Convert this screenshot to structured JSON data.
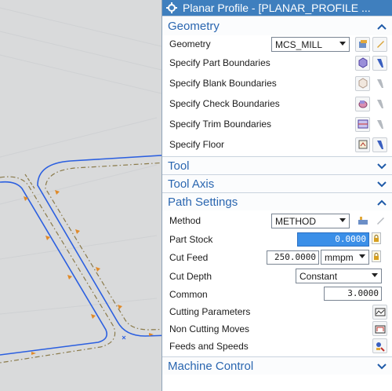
{
  "dialog": {
    "title": "Planar Profile - [PLANAR_PROFILE ..."
  },
  "geometry": {
    "header": "Geometry",
    "geometry_label": "Geometry",
    "geometry_value": "MCS_MILL",
    "part_boundaries": "Specify Part Boundaries",
    "blank_boundaries": "Specify Blank Boundaries",
    "check_boundaries": "Specify Check Boundaries",
    "trim_boundaries": "Specify Trim Boundaries",
    "floor": "Specify Floor"
  },
  "tool": {
    "header": "Tool"
  },
  "tool_axis": {
    "header": "Tool Axis"
  },
  "path_settings": {
    "header": "Path Settings",
    "method_label": "Method",
    "method_value": "METHOD",
    "part_stock_label": "Part Stock",
    "part_stock_value": "0.0000",
    "cut_feed_label": "Cut Feed",
    "cut_feed_value": "250.0000",
    "cut_feed_unit": "mmpm",
    "cut_depth_label": "Cut Depth",
    "cut_depth_value": "Constant",
    "common_label": "Common",
    "common_value": "3.0000",
    "cutting_parameters": "Cutting Parameters",
    "non_cutting_moves": "Non Cutting Moves",
    "feeds_and_speeds": "Feeds and Speeds"
  },
  "machine_control": {
    "header": "Machine Control"
  },
  "colors": {
    "title_bar": "#3f7fbe",
    "section_text": "#2a66b0",
    "highlight_field": "#3b8fe8",
    "path_line": "#2b5fe0",
    "boundary_line": "#8a7a4a"
  }
}
